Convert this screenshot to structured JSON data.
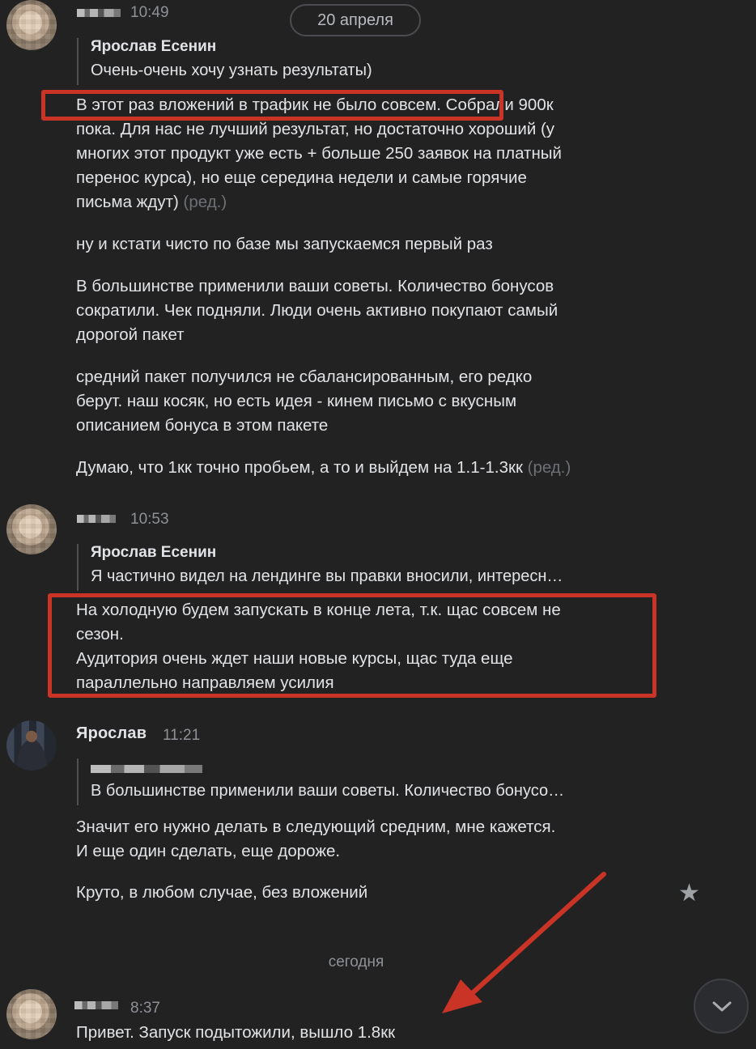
{
  "date_pill": "20 апреля",
  "today_label": "сегодня",
  "messages": [
    {
      "time": "10:49",
      "reply": {
        "author": "Ярослав Есенин",
        "text": "Очень-очень хочу узнать результаты)"
      },
      "paragraphs": [
        {
          "text": "В этот раз вложений в трафик не было совсем. Собрали 900к\nпока. Для нас не лучший результат, но достаточно хороший (у\nмногих этот продукт уже есть + больше 250 заявок на платный\nперенос курса), но еще середина недели и самые горячие\nписьма ждут)",
          "edited": "(ред.)"
        },
        {
          "text": "ну и кстати чисто по базе мы запускаемся первый раз"
        },
        {
          "text": "В большинстве применили ваши советы. Количество бонусов\nсократили. Чек подняли. Люди очень активно покупают самый\nдорогой пакет"
        },
        {
          "text": "средний пакет получился не сбалансированным, его редко\nберут. наш косяк, но есть идея - кинем письмо с вкусным\nописанием бонуса в этом пакете"
        },
        {
          "text": "Думаю, что 1кк точно пробьем, а то и выйдем на 1.1-1.3кк",
          "edited": "(ред.)"
        }
      ]
    },
    {
      "time": "10:53",
      "reply": {
        "author": "Ярослав Есенин",
        "text": "Я частично видел на лендинге вы правки вносили, интересн…"
      },
      "paragraphs": [
        {
          "text": "На холодную будем запускать в конце лета, т.к. щас совсем не\nсезон.\nАудитория очень ждет наши новые курсы, щас туда еще\nпараллельно направляем усилия"
        }
      ]
    },
    {
      "author": "Ярослав",
      "time": "11:21",
      "reply": {
        "text": "В большинстве применили ваши советы. Количество бонусо…"
      },
      "paragraphs": [
        {
          "text": "Значит его нужно делать в следующий средним, мне кажется.\nИ еще один сделать, еще дороже."
        },
        {
          "text": "Круто, в любом случае, без вложений"
        }
      ]
    },
    {
      "time": "8:37",
      "paragraphs": [
        {
          "text": "Привет. Запуск подытожили, вышло 1.8кк"
        }
      ]
    }
  ],
  "icons": {
    "star": "star-icon",
    "scroll_down": "chevron-down-icon",
    "annotation_arrow": "red-arrow"
  },
  "colors": {
    "background": "#222222",
    "text": "#e1e3e6",
    "muted": "#8e9196",
    "highlight": "#c93426"
  }
}
